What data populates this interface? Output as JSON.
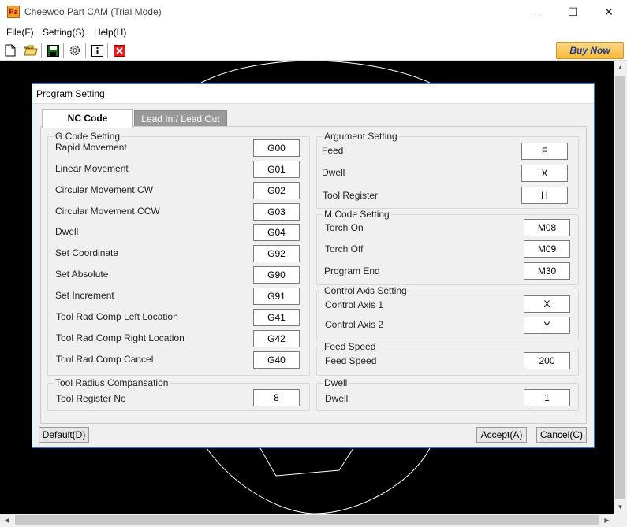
{
  "window": {
    "title": "Cheewoo Part CAM (Trial Mode)",
    "app_icon_text": "Pa",
    "minimize": "—",
    "maximize": "☐",
    "close": "✕"
  },
  "menu": [
    "File(F)",
    "Setting(S)",
    "Help(H)"
  ],
  "toolbar": {
    "icons": [
      "new-file-icon",
      "open-folder-icon",
      "save-icon",
      "settings-gear-icon",
      "info-icon",
      "delete-icon"
    ],
    "buy_now": "Buy Now"
  },
  "dialog": {
    "title": "Program Setting",
    "tabs": [
      "NC Code",
      "Lead In / Lead Out"
    ],
    "g_code": {
      "title": "G Code Setting",
      "rows": [
        {
          "label": "Rapid Movement",
          "value": "G00"
        },
        {
          "label": "Linear Movement",
          "value": "G01"
        },
        {
          "label": "Circular Movement CW",
          "value": "G02"
        },
        {
          "label": "Circular Movement CCW",
          "value": "G03"
        },
        {
          "label": "Dwell",
          "value": "G04"
        },
        {
          "label": "Set Coordinate",
          "value": "G92"
        },
        {
          "label": "Set Absolute",
          "value": "G90"
        },
        {
          "label": "Set Increment",
          "value": "G91"
        },
        {
          "label": "Tool Rad Comp Left Location",
          "value": "G41"
        },
        {
          "label": "Tool Rad Comp Right Location",
          "value": "G42"
        },
        {
          "label": "Tool Rad Comp Cancel",
          "value": "G40"
        }
      ]
    },
    "tool_radius": {
      "title": "Tool Radius Compansation",
      "rows": [
        {
          "label": "Tool Register No",
          "value": "8"
        }
      ]
    },
    "argument": {
      "title": "Argument Setting",
      "rows": [
        {
          "label": "Feed",
          "value": "F"
        },
        {
          "label": "Dwell",
          "value": "X"
        },
        {
          "label": "Tool Register",
          "value": "H"
        }
      ]
    },
    "m_code": {
      "title": "M Code Setting",
      "rows": [
        {
          "label": "Torch On",
          "value": "M08"
        },
        {
          "label": "Torch Off",
          "value": "M09"
        },
        {
          "label": "Program End",
          "value": "M30"
        }
      ]
    },
    "control_axis": {
      "title": "Control Axis Setting",
      "rows": [
        {
          "label": "Control Axis 1",
          "value": "X"
        },
        {
          "label": "Control Axis 2",
          "value": "Y"
        }
      ]
    },
    "feed_speed": {
      "title": "Feed Speed",
      "rows": [
        {
          "label": "Feed Speed",
          "value": "200"
        }
      ]
    },
    "dwell": {
      "title": "Dwell",
      "rows": [
        {
          "label": "Dwell",
          "value": "1"
        }
      ]
    },
    "buttons": {
      "default": "Default(D)",
      "accept": "Accept(A)",
      "cancel": "Cancel(C)"
    }
  }
}
